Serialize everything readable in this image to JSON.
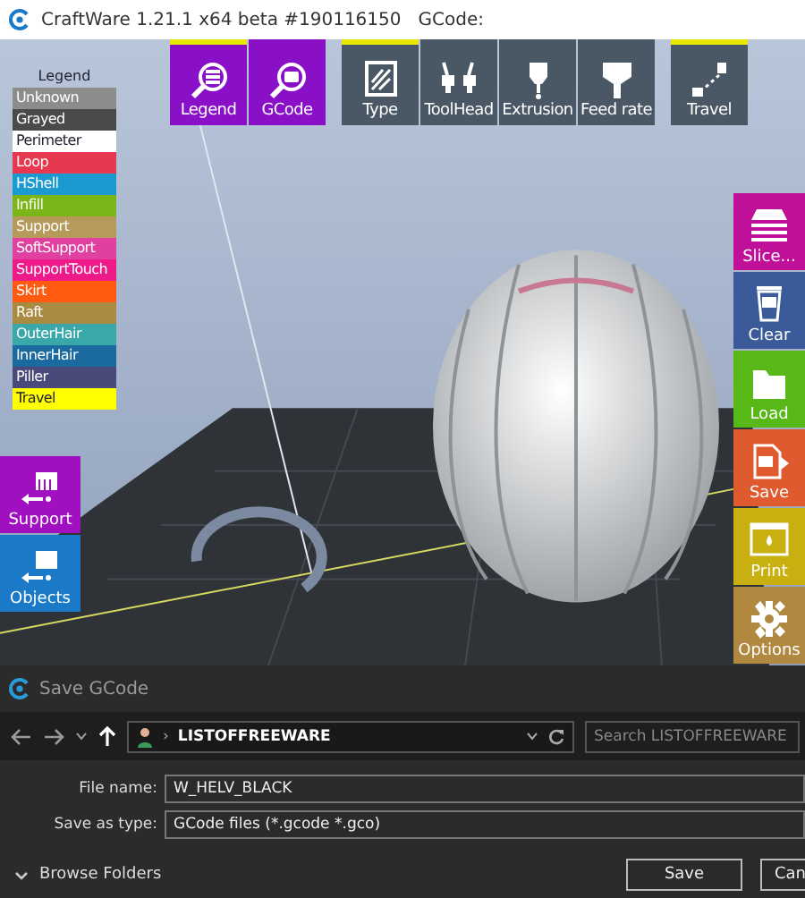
{
  "window": {
    "title": "CraftWare 1.21.1 x64 beta #190116150   GCode:"
  },
  "top_toolbar": [
    {
      "label": "Legend",
      "kind": "view",
      "selected": true
    },
    {
      "label": "GCode",
      "kind": "view",
      "selected": false
    },
    {
      "label": "Type",
      "kind": "mode",
      "selected": true
    },
    {
      "label": "ToolHead",
      "kind": "mode",
      "selected": false
    },
    {
      "label": "Extrusion",
      "kind": "mode",
      "selected": false
    },
    {
      "label": "Feed rate",
      "kind": "mode",
      "selected": false
    },
    {
      "label": "Travel",
      "kind": "mode",
      "selected": true
    }
  ],
  "legend": {
    "title": "Legend",
    "items": [
      {
        "label": "Unknown",
        "color": "#8c8c8c"
      },
      {
        "label": "Grayed",
        "color": "#4a4a4a"
      },
      {
        "label": "Perimeter",
        "color": "#ffffff"
      },
      {
        "label": "Loop",
        "color": "#e8384f"
      },
      {
        "label": "HShell",
        "color": "#1a9ad0"
      },
      {
        "label": "Infill",
        "color": "#7cb518"
      },
      {
        "label": "Support",
        "color": "#b59a5a"
      },
      {
        "label": "SoftSupport",
        "color": "#e040a0"
      },
      {
        "label": "SupportTouch",
        "color": "#ee1a8a"
      },
      {
        "label": "Skirt",
        "color": "#ff5a10"
      },
      {
        "label": "Raft",
        "color": "#a88a40"
      },
      {
        "label": "OuterHair",
        "color": "#3aa8a8"
      },
      {
        "label": "InnerHair",
        "color": "#1a6aa0"
      },
      {
        "label": "Piller",
        "color": "#4a4a7a"
      },
      {
        "label": "Travel",
        "color": "#ffff00"
      }
    ]
  },
  "left_toolbar": [
    {
      "label": "Support",
      "color": "#a010c0"
    },
    {
      "label": "Objects",
      "color": "#1a7ac8"
    }
  ],
  "right_toolbar": [
    {
      "label": "Slice...",
      "color": "#c0109a"
    },
    {
      "label": "Clear",
      "color": "#3a5a9a"
    },
    {
      "label": "Load",
      "color": "#58b818"
    },
    {
      "label": "Save",
      "color": "#e05a30"
    },
    {
      "label": "Print",
      "color": "#c8b010"
    },
    {
      "label": "Options",
      "color": "#b08840"
    }
  ],
  "dialog": {
    "title": "Save GCode",
    "breadcrumb_separator": "›",
    "path": "LISTOFFREEWARE",
    "search": {
      "placeholder": "Search LISTOFFREEWARE"
    },
    "file_name": {
      "label": "File name:",
      "value": "W_HELV_BLACK"
    },
    "save_as_type": {
      "label": "Save as type:",
      "value": "GCode files (*.gcode *.gco)"
    },
    "browse_folders": "Browse Folders",
    "buttons": [
      "Save",
      "Can"
    ]
  }
}
